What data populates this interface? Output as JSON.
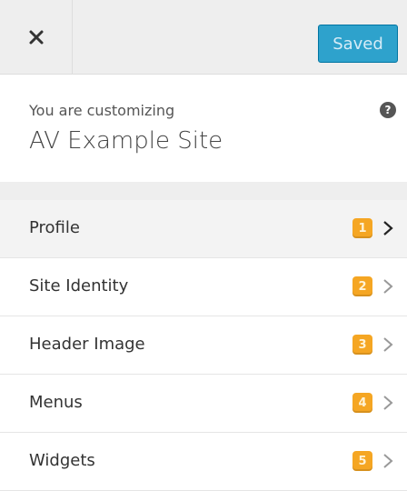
{
  "topbar": {
    "saved_label": "Saved"
  },
  "info": {
    "pre_text": "You are customizing",
    "site_name": "AV Example Site",
    "help_glyph": "?"
  },
  "sections": [
    {
      "label": "Profile",
      "badge": "1"
    },
    {
      "label": "Site Identity",
      "badge": "2"
    },
    {
      "label": "Header Image",
      "badge": "3"
    },
    {
      "label": "Menus",
      "badge": "4"
    },
    {
      "label": "Widgets",
      "badge": "5"
    }
  ],
  "colors": {
    "accent": "#2ea2cc",
    "badge": "#f5a623",
    "topbar_bg": "#eeeeee"
  }
}
